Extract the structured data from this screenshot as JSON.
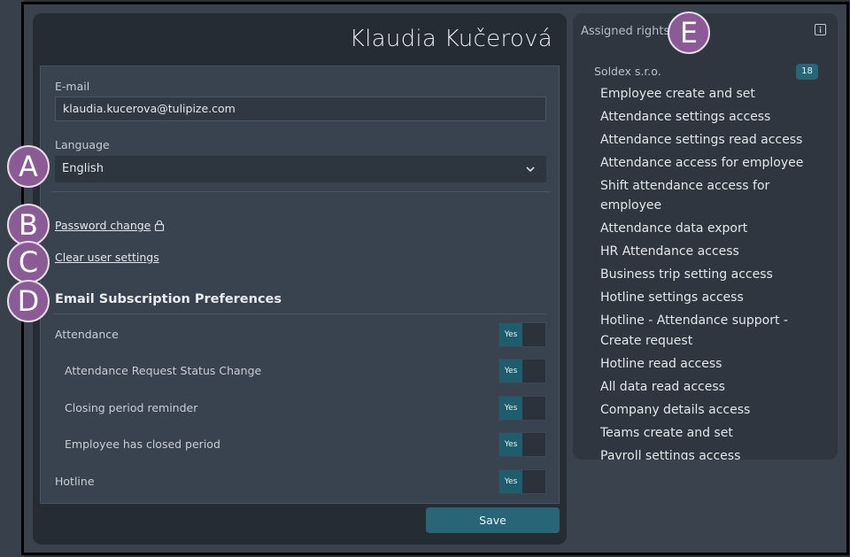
{
  "user": {
    "name": "Klaudia Kučerová"
  },
  "form": {
    "email_label": "E-mail",
    "email_value": "klaudia.kucerova@tulipize.com",
    "language_label": "Language",
    "language_value": "English",
    "password_link": "Password change",
    "clear_link": "Clear user settings"
  },
  "subscriptions": {
    "title": "Email Subscription Preferences",
    "rows": [
      {
        "label": "Attendance",
        "value": "Yes"
      },
      {
        "label": "Attendance Request Status Change",
        "value": "Yes"
      },
      {
        "label": "Closing period reminder",
        "value": "Yes"
      },
      {
        "label": "Employee has closed period",
        "value": "Yes"
      },
      {
        "label": "Hotline",
        "value": "Yes"
      }
    ]
  },
  "save_label": "Save",
  "rights": {
    "title": "Assigned rights",
    "company": "Soldex s.r.o.",
    "count": "18",
    "items": [
      "Employee create and set",
      "Attendance settings access",
      "Attendance settings read access",
      "Attendance access for employee",
      "Shift attendance access for employee",
      "Attendance data export",
      "HR Attendance access",
      "Business trip setting access",
      "Hotline settings access",
      "Hotline - Attendance support - Create request",
      "Hotline read access",
      "All data read access",
      "Company details access",
      "Teams create and set",
      "Payroll settings access"
    ]
  },
  "markers": [
    "A",
    "B",
    "C",
    "D",
    "E"
  ],
  "colors": {
    "accent": "#276577",
    "toggle_on": "#1f5d6c",
    "marker": "#8a5b95"
  }
}
